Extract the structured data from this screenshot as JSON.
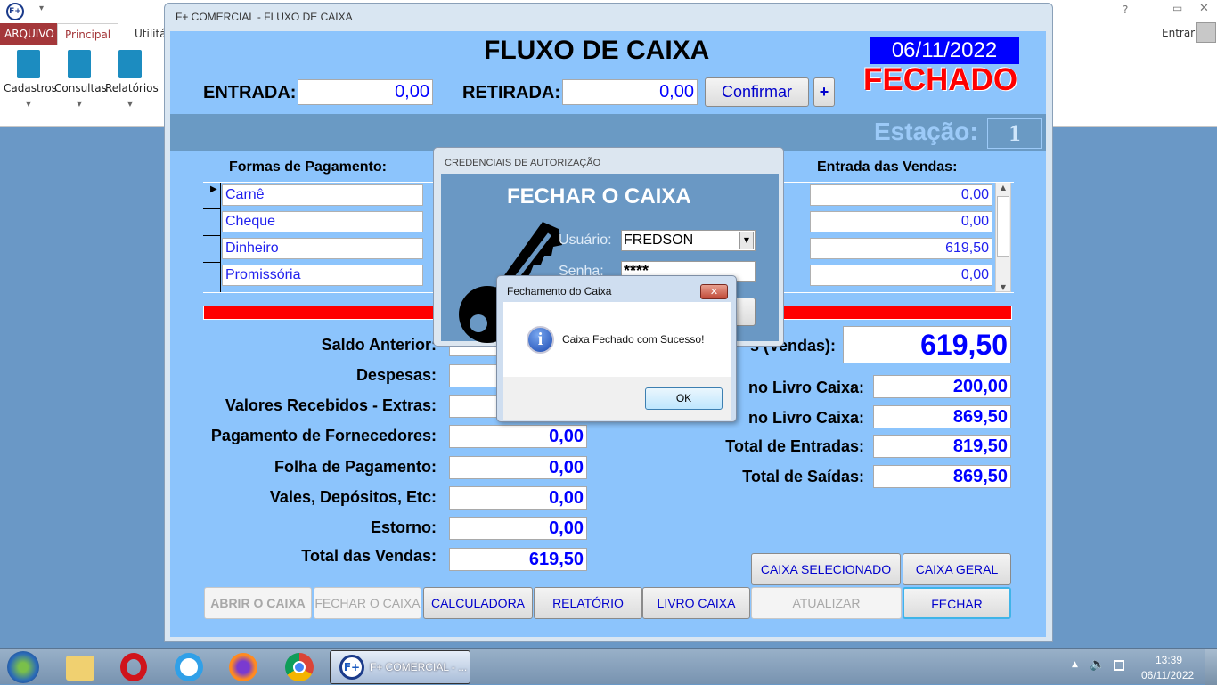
{
  "ribbon": {
    "tabs": [
      "ARQUIVO",
      "Principal",
      "Utilitá"
    ],
    "buttons": [
      "Cadastros",
      "Consultas",
      "Relatórios"
    ],
    "help": "?",
    "signin": "Entrar"
  },
  "window": {
    "title": "F+ COMERCIAL - FLUXO DE CAIXA"
  },
  "header": {
    "title": "FLUXO DE CAIXA",
    "date": "06/11/2022",
    "status": "FECHADO",
    "status_color": "#ff0000",
    "entrada_label": "ENTRADA:",
    "entrada_value": "0,00",
    "retirada_label": "RETIRADA:",
    "retirada_value": "0,00",
    "confirm_label": "Confirmar",
    "plus_label": "+",
    "station_label": "Estação:",
    "station_value": "1"
  },
  "payments": {
    "left_header": "Formas de Pagamento:",
    "right_header": "Entrada das Vendas:",
    "rows": [
      {
        "name": "Carnê",
        "value": "0,00"
      },
      {
        "name": "Cheque",
        "value": "0,00"
      },
      {
        "name": "Dinheiro",
        "value": "619,50"
      },
      {
        "name": "Promissória",
        "value": "0,00"
      }
    ]
  },
  "left_summary": [
    {
      "label": "Saldo Anterior:",
      "value": ""
    },
    {
      "label": "Despesas:",
      "value": ""
    },
    {
      "label": "Valores Recebidos - Extras:",
      "value": ""
    },
    {
      "label": "Pagamento de Fornecedores:",
      "value": "0,00"
    },
    {
      "label": "Folha de Pagamento:",
      "value": "0,00"
    },
    {
      "label": "Vales, Depósitos, Etc:",
      "value": "0,00"
    },
    {
      "label": "Estorno:",
      "value": "0,00"
    },
    {
      "label": "Total das Vendas:",
      "value": "619,50"
    }
  ],
  "right_summary": {
    "big_label": "s (Vendas):",
    "big_value": "619,50",
    "rows": [
      {
        "label": "no Livro Caixa:",
        "value": "200,00"
      },
      {
        "label": "no Livro Caixa:",
        "value": "869,50"
      },
      {
        "label": "Total de Entradas:",
        "value": "819,50"
      },
      {
        "label": "Total de Saídas:",
        "value": "869,50"
      }
    ]
  },
  "buttons": {
    "caixa_selecionado": "CAIXA SELECIONADO",
    "caixa_geral": "CAIXA GERAL",
    "abrir": "ABRIR O CAIXA",
    "fechar_caixa": "FECHAR O CAIXA",
    "calculadora": "CALCULADORA",
    "relatorio": "RELATÓRIO",
    "livro_caixa": "LIVRO CAIXA",
    "atualizar": "ATUALIZAR",
    "fechar": "FECHAR"
  },
  "cred_dialog": {
    "title": "CREDENCIAIS DE AUTORIZAÇÃO",
    "heading": "FECHAR O CAIXA",
    "user_label": "Usuário:",
    "user_value": "FREDSON",
    "password_label": "Senha:",
    "password_value": "****"
  },
  "msg_dialog": {
    "title": "Fechamento do Caixa",
    "message": "Caixa Fechado com Sucesso!",
    "ok": "OK",
    "icon": "info-icon"
  },
  "taskbar": {
    "app_label": "F+ COMERCIAL - ...",
    "time": "13:39",
    "date": "06/11/2022"
  }
}
